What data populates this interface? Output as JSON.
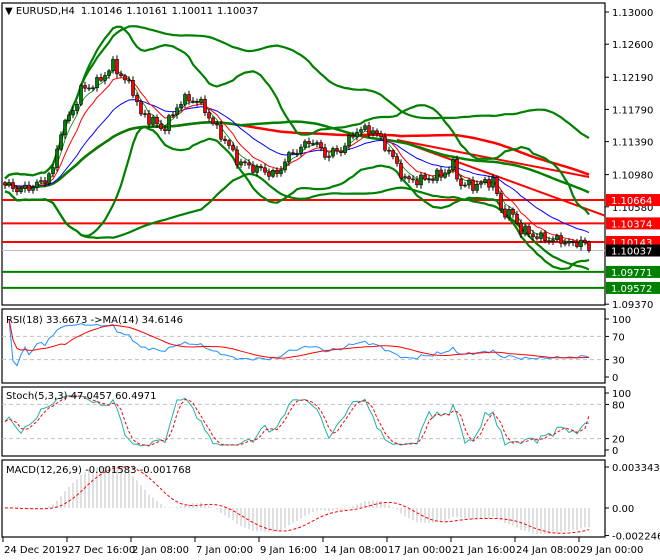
{
  "chart_data": {
    "type": "candlestick",
    "symbol": "EURUSD,H4",
    "ohlc": [
      "1.10146",
      "1.10161",
      "1.10011",
      "1.10037"
    ],
    "last": {
      "open": 1.10146,
      "high": 1.10161,
      "low": 1.10011,
      "close": 1.10037
    },
    "ylim": [
      1.0936,
      1.13112
    ],
    "y_ticks": [
      {
        "value": 1.13,
        "label": "1.13000"
      },
      {
        "value": 1.126,
        "label": "1.12600"
      },
      {
        "value": 1.1219,
        "label": "1.12190"
      },
      {
        "value": 1.1179,
        "label": "1.11790"
      },
      {
        "value": 1.1139,
        "label": "1.11390"
      },
      {
        "value": 1.1098,
        "label": "1.10980"
      },
      {
        "value": 1.1058,
        "label": "1.10580"
      },
      {
        "value": 1.0937,
        "label": "1.09370"
      }
    ],
    "bars": 147,
    "close_anchors": [
      [
        0,
        1.10851
      ],
      [
        4,
        1.10789
      ],
      [
        9,
        1.10876
      ],
      [
        12,
        1.11037
      ],
      [
        14,
        1.11534
      ],
      [
        17,
        1.11783
      ],
      [
        19,
        1.12031
      ],
      [
        23,
        1.12118
      ],
      [
        27,
        1.12342
      ],
      [
        29,
        1.12217
      ],
      [
        32,
        1.12031
      ],
      [
        34,
        1.1172
      ],
      [
        37,
        1.11658
      ],
      [
        39,
        1.11534
      ],
      [
        42,
        1.1172
      ],
      [
        44,
        1.11907
      ],
      [
        48,
        1.11907
      ],
      [
        50,
        1.11783
      ],
      [
        53,
        1.11534
      ],
      [
        55,
        1.1141
      ],
      [
        58,
        1.11162
      ],
      [
        60,
        1.11099
      ],
      [
        64,
        1.11037
      ],
      [
        68,
        1.10975
      ],
      [
        70,
        1.11162
      ],
      [
        73,
        1.11286
      ],
      [
        77,
        1.1141
      ],
      [
        80,
        1.11224
      ],
      [
        84,
        1.11286
      ],
      [
        88,
        1.11534
      ],
      [
        92,
        1.11534
      ],
      [
        95,
        1.11348
      ],
      [
        98,
        1.11099
      ],
      [
        100,
        1.10913
      ],
      [
        104,
        1.10913
      ],
      [
        109,
        1.10975
      ],
      [
        112,
        1.11099
      ],
      [
        114,
        1.10851
      ],
      [
        118,
        1.10851
      ],
      [
        122,
        1.10913
      ],
      [
        124,
        1.1054
      ],
      [
        127,
        1.10478
      ],
      [
        129,
        1.10292
      ],
      [
        132,
        1.1023
      ],
      [
        134,
        1.10193
      ],
      [
        137,
        1.10168
      ],
      [
        139,
        1.10168
      ],
      [
        142,
        1.10106
      ],
      [
        144,
        1.10168
      ],
      [
        146,
        1.10037
      ]
    ],
    "levels": [
      {
        "price": 1.10664,
        "label": "1.10664",
        "color": "#ff0000"
      },
      {
        "price": 1.10374,
        "label": "1.10374",
        "color": "#ff0000"
      },
      {
        "price": 1.10143,
        "label": "1.10143",
        "color": "#ff0000"
      },
      {
        "price": 1.10037,
        "label": "1.10037",
        "color": "#000000",
        "line": "#c0c0c0"
      },
      {
        "price": 1.09771,
        "label": "1.09771",
        "color": "#008000"
      },
      {
        "price": 1.09572,
        "label": "1.09572",
        "color": "#008000"
      }
    ],
    "trendlines": [
      {
        "from": [
          98,
          1.1141
        ],
        "to": [
          146,
          1.1095
        ],
        "color": "#ff0000"
      },
      {
        "from": [
          98,
          1.1141
        ],
        "to": [
          150,
          1.1047
        ],
        "color": "#ff0000"
      }
    ],
    "x_ticks": [
      {
        "bar": 0,
        "label": "24 Dec 2019"
      },
      {
        "bar": 16,
        "label": "27 Dec 16:00"
      },
      {
        "bar": 32,
        "label": "2 Jan 08:00"
      },
      {
        "bar": 48,
        "label": "7 Jan 00:00"
      },
      {
        "bar": 64,
        "label": "9 Jan 16:00"
      },
      {
        "bar": 80,
        "label": "14 Jan 08:00"
      },
      {
        "bar": 96,
        "label": "17 Jan 00:00"
      },
      {
        "bar": 112,
        "label": "21 Jan 16:00"
      },
      {
        "bar": 128,
        "label": "24 Jan 08:00"
      },
      {
        "bar": 144,
        "label": "29 Jan 00:00"
      }
    ],
    "colors": {
      "bull": "#008000",
      "bear": "#ff0000",
      "ema_fast": "#ff0000",
      "ema_slow": "#0000ff",
      "bands": "#008000",
      "long_ma_green": "#008000",
      "long_ma_red": "#ff0000"
    },
    "indicators": {
      "rsi": {
        "label": "RSI(18) 33.6673  ->MA(14) 34.6146",
        "period": 18,
        "ma_period": 14,
        "ylim": [
          0,
          100
        ],
        "ticks": [
          {
            "value": 100,
            "label": "100"
          },
          {
            "value": 70,
            "label": "70"
          },
          {
            "value": 30,
            "label": "30"
          },
          {
            "value": 0,
            "label": "0"
          }
        ],
        "levels": [
          70,
          30
        ],
        "value": 33.6673,
        "ma_value": 34.6146
      },
      "stoch": {
        "label": "Stoch(5,3,3) 47.0457 60.4971",
        "k": 5,
        "d": 3,
        "slowing": 3,
        "ylim": [
          0,
          100
        ],
        "ticks": [
          {
            "value": 100,
            "label": "100"
          },
          {
            "value": 80,
            "label": "80"
          },
          {
            "value": 20,
            "label": "20"
          },
          {
            "value": 0,
            "label": "0"
          }
        ],
        "levels": [
          80,
          20
        ],
        "main": 47.0457,
        "signal": 60.4971
      },
      "macd": {
        "label": "MACD(12,26,9) -0.001583 -0.001768",
        "fast": 12,
        "slow": 26,
        "signal": 9,
        "ylim": [
          -0.002246,
          0.003343
        ],
        "ticks": [
          {
            "value": 0.003343,
            "label": "0.003343"
          },
          {
            "value": 0,
            "label": "0.00"
          },
          {
            "value": -0.002246,
            "label": "-0.002246"
          }
        ],
        "main": -0.001583,
        "signal_value": -0.001768
      }
    }
  }
}
